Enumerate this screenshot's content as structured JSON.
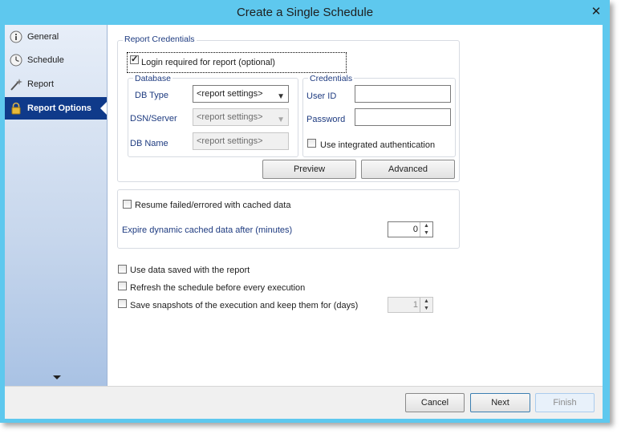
{
  "window": {
    "title": "Create a Single Schedule",
    "close_glyph": "✕"
  },
  "sidebar": {
    "items": [
      {
        "label": "General",
        "icon": "info-icon"
      },
      {
        "label": "Schedule",
        "icon": "clock-icon"
      },
      {
        "label": "Report",
        "icon": "wand-icon"
      },
      {
        "label": "Report Options",
        "icon": "lock-icon",
        "active": true
      }
    ]
  },
  "report_credentials": {
    "title": "Report Credentials",
    "login_required": {
      "label": "Login required for report (optional)",
      "checked": true
    },
    "database": {
      "title": "Database",
      "db_type_label": "DB Type",
      "db_type_value": "<report settings>",
      "dsn_label": "DSN/Server",
      "dsn_value": "<report settings>",
      "db_name_label": "DB Name",
      "db_name_value": "<report settings>"
    },
    "credentials": {
      "title": "Credentials",
      "user_id_label": "User ID",
      "user_id_value": "",
      "password_label": "Password",
      "password_value": "",
      "integrated_auth": {
        "label": "Use integrated authentication",
        "checked": false
      }
    },
    "preview_button": "Preview",
    "advanced_button": "Advanced"
  },
  "cache": {
    "resume_failed": {
      "label": "Resume failed/errored with cached data",
      "checked": false
    },
    "expire_label": "Expire dynamic cached data after (minutes)",
    "expire_value": "0"
  },
  "options": {
    "use_saved_data": {
      "label": "Use data saved with the report",
      "checked": false
    },
    "refresh_schedule": {
      "label": "Refresh the schedule before every execution",
      "checked": false
    },
    "save_snapshots": {
      "label": "Save snapshots of the execution and keep them for (days)",
      "checked": false
    },
    "snapshot_days": "1"
  },
  "footer": {
    "cancel": "Cancel",
    "next": "Next",
    "finish": "Finish"
  },
  "colors": {
    "titlebar": "#5ec8ee",
    "active_nav": "#0f3a8a",
    "label_blue": "#1e3b80"
  }
}
